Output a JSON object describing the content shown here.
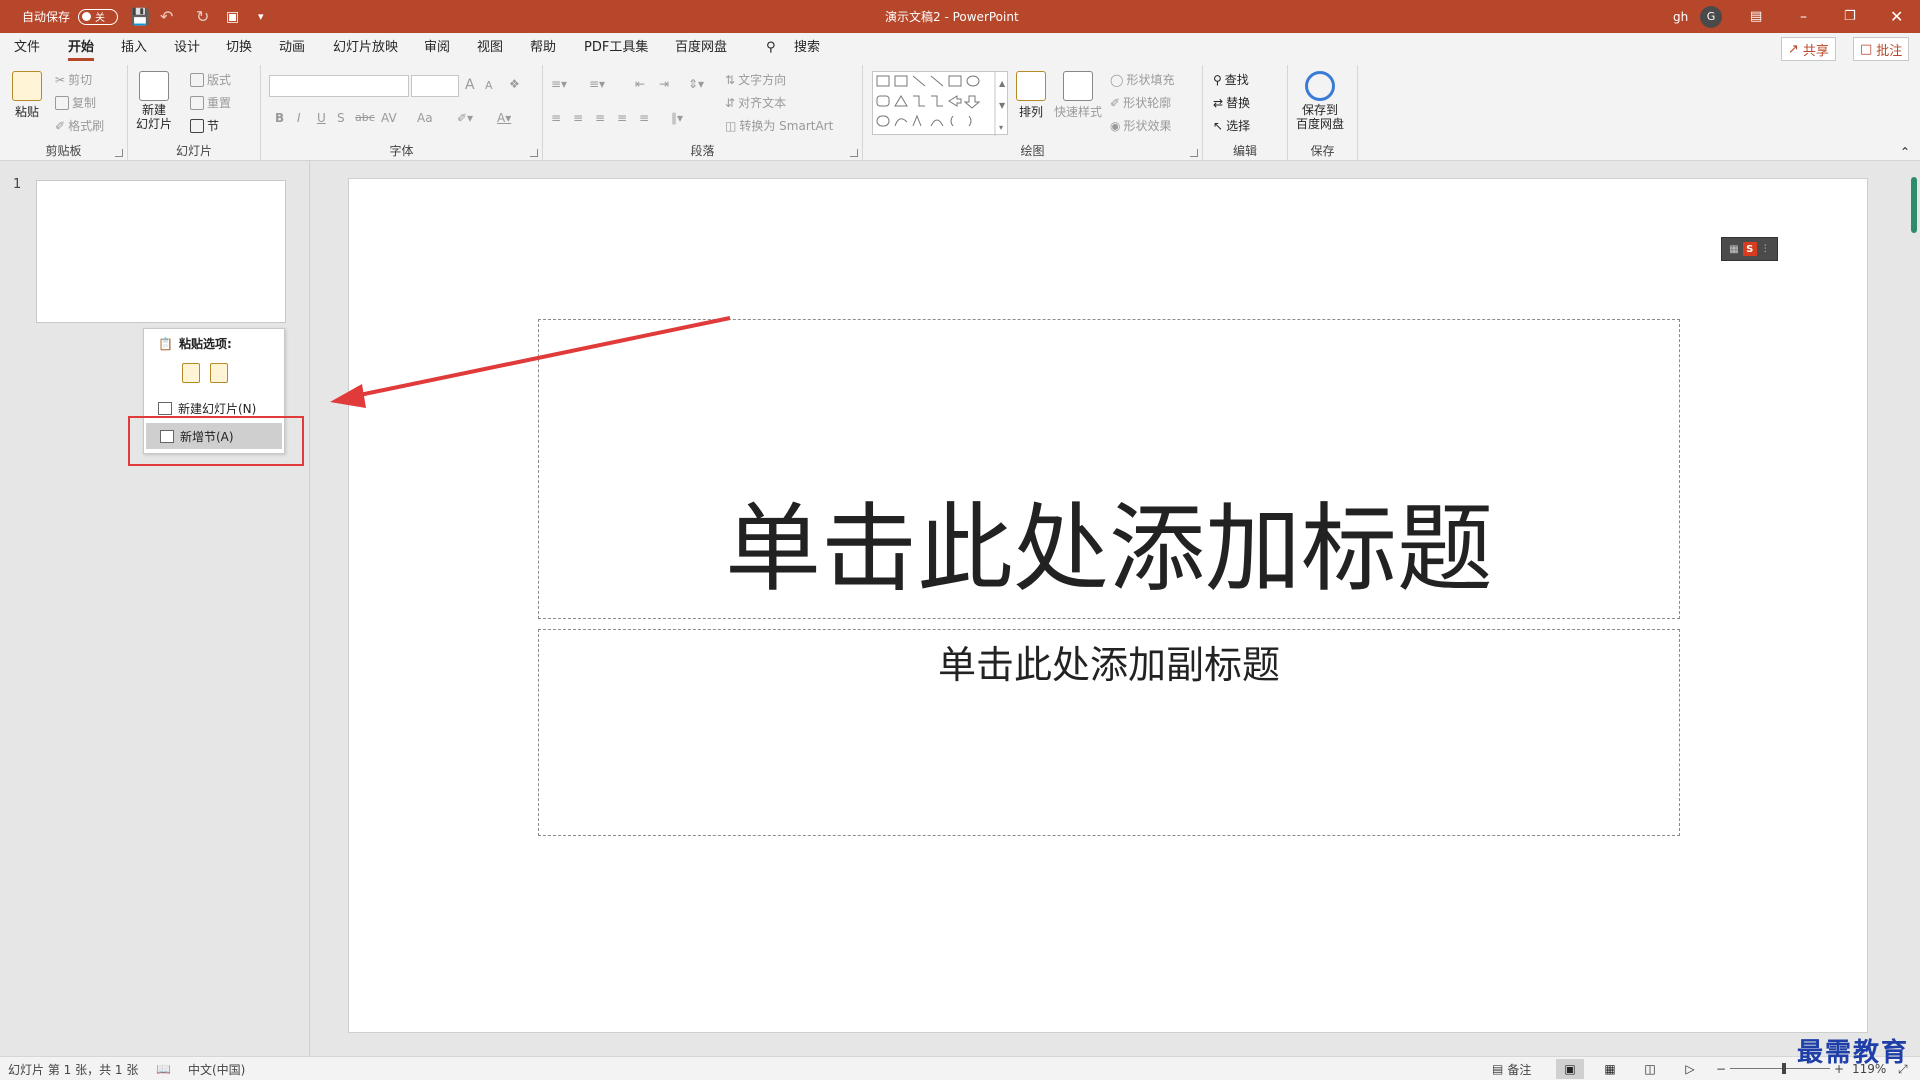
{
  "titlebar": {
    "autosave_label": "自动保存",
    "autosave_state": "关",
    "doc_title": "演示文稿2  -  PowerPoint",
    "user": "gh",
    "avatar_initial": "G"
  },
  "menu": {
    "tabs": [
      "文件",
      "开始",
      "插入",
      "设计",
      "切换",
      "动画",
      "幻灯片放映",
      "审阅",
      "视图",
      "帮助",
      "PDF工具集",
      "百度网盘"
    ],
    "active_tab": "开始",
    "search": "搜索",
    "share": "共享",
    "comments": "批注"
  },
  "ribbon": {
    "clipboard": {
      "label": "剪贴板",
      "paste": "粘贴",
      "cut": "剪切",
      "copy": "复制",
      "format_painter": "格式刷"
    },
    "slides": {
      "label": "幻灯片",
      "new_slide_line1": "新建",
      "new_slide_line2": "幻灯片",
      "layout": "版式",
      "reset": "重置",
      "section": "节"
    },
    "font": {
      "label": "字体",
      "bold": "B",
      "italic": "I",
      "underline": "U",
      "shadow": "S",
      "strike": "abc",
      "spacing": "AV",
      "case": "Aa",
      "grow": "A",
      "shrink": "A"
    },
    "paragraph": {
      "label": "段落",
      "text_direction": "文字方向",
      "align_text": "对齐文本",
      "smartart": "转换为 SmartArt"
    },
    "drawing": {
      "label": "绘图",
      "arrange": "排列",
      "quick_styles": "快速样式",
      "shape_fill": "形状填充",
      "shape_outline": "形状轮廓",
      "shape_effects": "形状效果"
    },
    "editing": {
      "label": "编辑",
      "find": "查找",
      "replace": "替换",
      "select": "选择"
    },
    "save": {
      "label": "保存",
      "line1": "保存到",
      "line2": "百度网盘"
    }
  },
  "thumbnails": {
    "slide_number": "1"
  },
  "context_menu": {
    "paste_options": "粘贴选项:",
    "new_slide": "新建幻灯片(N)",
    "add_section": "新增节(A)"
  },
  "slide": {
    "title_placeholder": "单击此处添加标题",
    "subtitle_placeholder": "单击此处添加副标题",
    "ime_icon": "S"
  },
  "statusbar": {
    "slide_info": "幻灯片 第 1 张，共 1 张",
    "language": "中文(中国)",
    "notes": "备注",
    "zoom_minus": "−",
    "zoom_plus": "+",
    "zoom": "119%"
  },
  "watermark": "最需教育",
  "colors": {
    "accent": "#b7472a",
    "highlight_box": "#e03a3a"
  }
}
